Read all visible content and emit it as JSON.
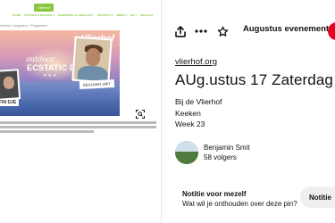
{
  "pin_image": {
    "site": {
      "logo_text": "Vlierhof",
      "nav": [
        "HOME",
        "PRIJZEN & BOEKEN ▾",
        "GEMEENTE & VERHUUR ▾",
        "REPORTS ▾",
        "MEER ▾",
        "DE ▾",
        "ENGLISH"
      ],
      "breadcrumb": "Vlierhof > Augustus > Programma"
    },
    "poster": {
      "brand": "Vlierhof",
      "title_small": "outdoor",
      "title": "ECSTATIC DANCE",
      "stars": "✦ ✦ ✦",
      "badge_left": "FIN DJE",
      "badge_right": "BENJAMIN SMIT"
    }
  },
  "toolbar": {
    "share_icon": "share-icon",
    "more_icon": "more-icon",
    "star_icon": "star-icon",
    "board_label": "Augustus evenementen",
    "chevron_icon": "chevron-down-icon"
  },
  "pin": {
    "source": "vlierhof.org",
    "title": "AUg.ustus 17 Zaterdag",
    "description_lines": [
      "Bij de Vlierhof",
      "Keeken",
      "Week 23"
    ]
  },
  "creator": {
    "name": "Benjamin Smit",
    "followers": "58 volgers"
  },
  "note": {
    "title": "Notitie voor mezelf",
    "subtitle": "Wat wil je onthouden over deze pin?",
    "button": "Notitie"
  },
  "colors": {
    "accent_red": "#e60023",
    "site_green": "#8cc63f"
  }
}
